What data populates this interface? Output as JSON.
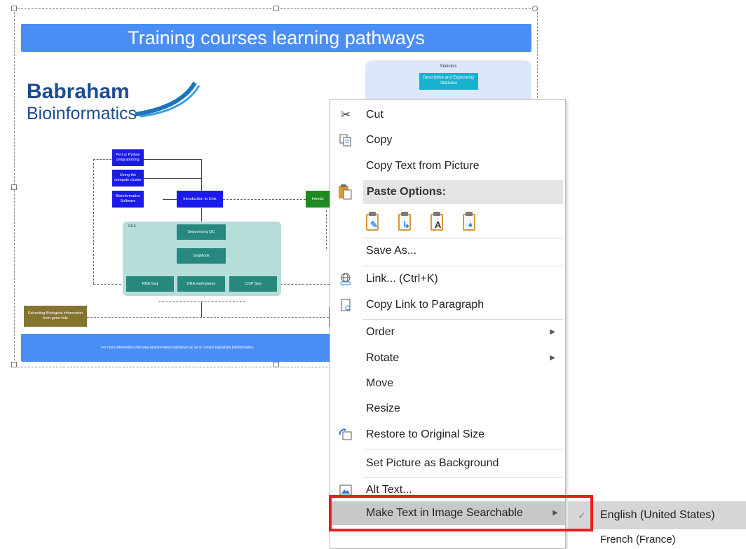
{
  "slide": {
    "title": "Training courses learning pathways",
    "logo_line1": "Babraham",
    "logo_line2": "Bioinformatics",
    "stats_label": "Statistics",
    "stats_box": "Descriptive and Exploratory Statistics",
    "perl_python": "Perl or Python programming",
    "cluster": "Using the compute cluster",
    "software": "Bioinformatics Software",
    "unix": "Introduction to Unix",
    "intro_r": "Introdu",
    "ngs_label": "NGS",
    "seq_qc": "Sequencing QC",
    "seqmonk": "SeqMonk",
    "rnaseq": "RNA Seq",
    "dnameth": "DNA methylation",
    "chipseq": "ChIP Seq",
    "extract": "Extracting Biological information from gene lists",
    "footer": "For more information visit www.bioinformatics.babraham.ac.uk or contact babraham.bioinformatics"
  },
  "menu": {
    "cut": "Cut",
    "copy": "Copy",
    "copy_text": "Copy Text from Picture",
    "paste_options": "Paste Options:",
    "save_as": "Save As...",
    "link": "Link...  (Ctrl+K)",
    "copy_link": "Copy Link to Paragraph",
    "order": "Order",
    "rotate": "Rotate",
    "move": "Move",
    "resize": "Resize",
    "restore": "Restore to Original Size",
    "set_bg": "Set Picture as Background",
    "alt_text": "Alt Text...",
    "make_searchable": "Make Text in Image Searchable"
  },
  "submenu": {
    "english": "English (United States)",
    "french": "French (France)"
  },
  "colors": {
    "highlight_border": "#ee1c1c",
    "title_bar": "#4a8ef5"
  }
}
